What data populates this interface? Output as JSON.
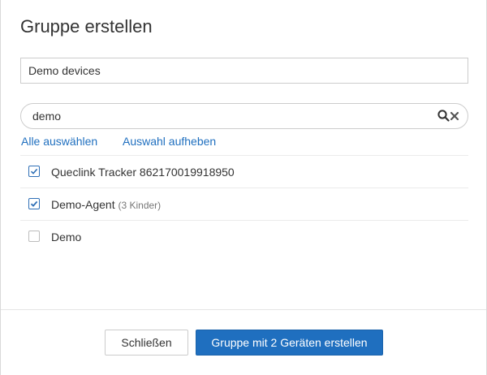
{
  "dialog": {
    "title": "Gruppe erstellen",
    "group_name_value": "Demo devices"
  },
  "search": {
    "value": "demo",
    "search_icon": "search-icon",
    "clear_icon": "clear-icon"
  },
  "links": {
    "select_all": "Alle auswählen",
    "deselect": "Auswahl aufheben"
  },
  "items": [
    {
      "label": "Queclink Tracker 862170019918950",
      "sub": "",
      "checked": true
    },
    {
      "label": "Demo-Agent",
      "sub": "(3 Kinder)",
      "checked": true
    },
    {
      "label": "Demo",
      "sub": "",
      "checked": false
    }
  ],
  "footer": {
    "close_label": "Schließen",
    "create_label": "Gruppe mit 2 Geräten erstellen"
  },
  "colors": {
    "accent": "#1f6fbf",
    "text": "#333333"
  }
}
